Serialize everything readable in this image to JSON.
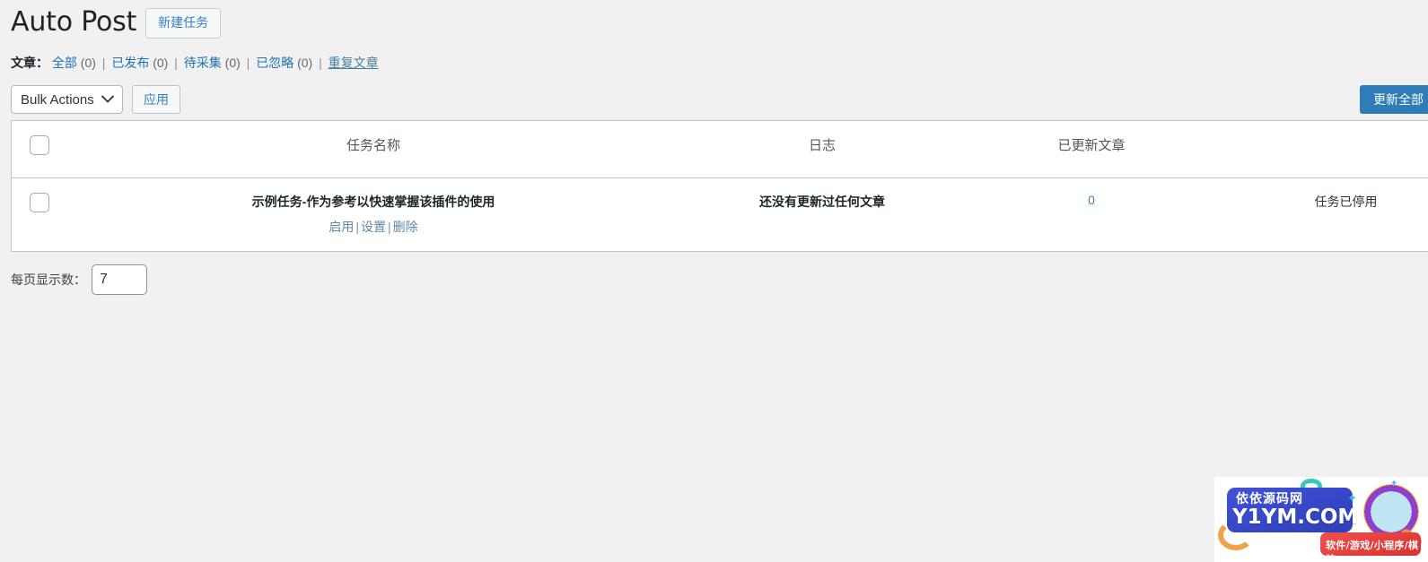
{
  "header": {
    "title": "Auto Post",
    "new_task_button": "新建任务"
  },
  "filters": {
    "prefix": "文章",
    "colon": "：",
    "items": [
      {
        "label": "全部",
        "count": "(0)",
        "hovered": false
      },
      {
        "label": "已发布",
        "count": "(0)",
        "hovered": false
      },
      {
        "label": "待采集",
        "count": "(0)",
        "hovered": false
      },
      {
        "label": "已忽略",
        "count": "(0)",
        "hovered": false
      },
      {
        "label": "重复文章",
        "count": "",
        "hovered": true
      }
    ],
    "separator": "|"
  },
  "tablenav": {
    "bulk_actions_label": "Bulk Actions",
    "bulk_actions_options": [
      "Bulk Actions"
    ],
    "apply_button": "应用",
    "update_all_button": "更新全部",
    "chevron_icon": "chevron-down-icon"
  },
  "table": {
    "columns": [
      {
        "key": "cb",
        "label": ""
      },
      {
        "key": "name",
        "label": "任务名称"
      },
      {
        "key": "log",
        "label": "日志"
      },
      {
        "key": "count",
        "label": "已更新文章"
      },
      {
        "key": "state",
        "label": ""
      }
    ],
    "rows": [
      {
        "title": "示例任务-作为参考以快速掌握该插件的使用",
        "actions": [
          "启用",
          "设置",
          "删除"
        ],
        "action_separator": "|",
        "log": "还没有更新过任何文章",
        "updated_count": "0",
        "state": "任务已停用"
      }
    ]
  },
  "footer": {
    "per_page_label": "每页显示数：",
    "per_page_value": "7"
  },
  "watermark": {
    "site_cn": "依依源码网",
    "site_domain": "Y1YM.COM",
    "tagline": "软件/游戏/小程序/棋牌",
    "spark": "✦",
    "spark2": "✦"
  },
  "colors": {
    "page_bg": "#f1f1f1",
    "link": "#2271b1",
    "primary_button": "#2e7cb8",
    "text": "#3c434a"
  }
}
